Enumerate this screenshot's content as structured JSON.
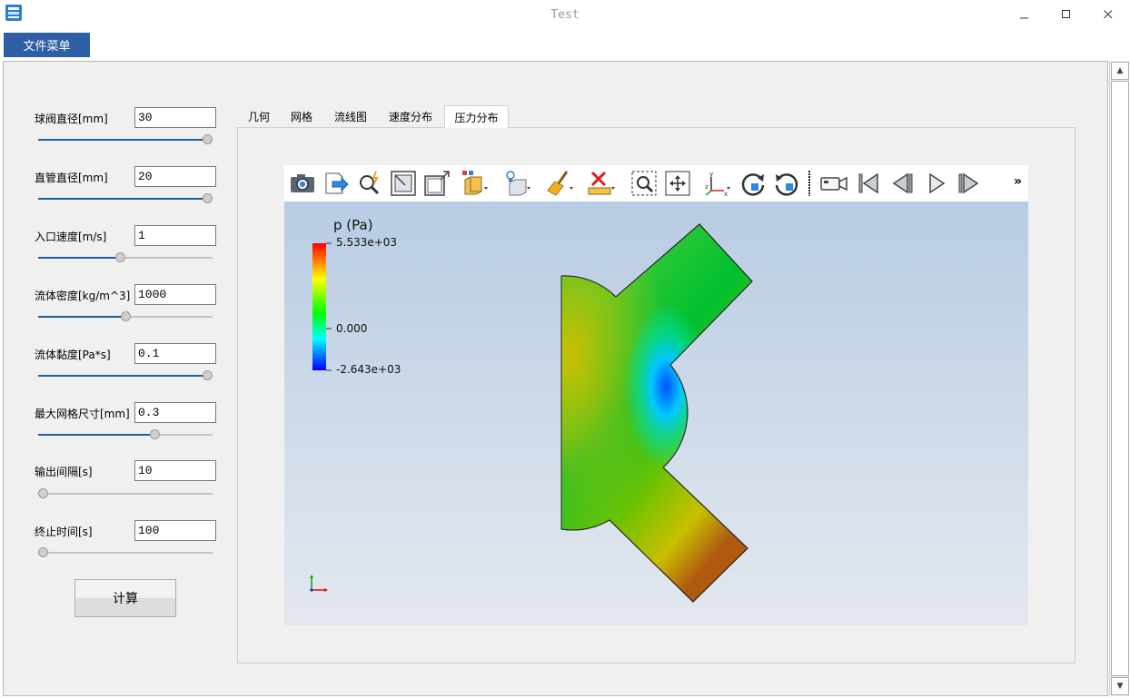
{
  "window": {
    "title": "Test",
    "minimize_icon": "minimize-icon",
    "maximize_icon": "maximize-icon",
    "close_icon": "close-icon",
    "app_icon": "app-icon"
  },
  "menu": {
    "file_menu_label": "文件菜单"
  },
  "parameters": [
    {
      "label": "球阀直径[mm]",
      "value": "30",
      "slider_fraction": 1.0
    },
    {
      "label": "直管直径[mm]",
      "value": "20",
      "slider_fraction": 1.0
    },
    {
      "label": "入口速度[m/s]",
      "value": "1",
      "slider_fraction": 0.47
    },
    {
      "label": "流体密度[kg/m^3]",
      "value": "1000",
      "slider_fraction": 0.505
    },
    {
      "label": "流体黏度[Pa*s]",
      "value": "0.1",
      "slider_fraction": 1.0
    },
    {
      "label": "最大网格尺寸[mm]",
      "value": "0.3",
      "slider_fraction": 0.68
    },
    {
      "label": "输出间隔[s]",
      "value": "10",
      "slider_fraction": 0.0
    },
    {
      "label": "终止时间[s]",
      "value": "100",
      "slider_fraction": 0.0
    }
  ],
  "compute_button_label": "计算",
  "tabs": [
    {
      "label": "几何",
      "active": false
    },
    {
      "label": "网格",
      "active": false
    },
    {
      "label": "流线图",
      "active": false
    },
    {
      "label": "速度分布",
      "active": false
    },
    {
      "label": "压力分布",
      "active": true
    }
  ],
  "toolbar": {
    "icons": [
      "screenshot-camera-icon",
      "export-icon",
      "zoom-magic-icon",
      "fit-view-icon",
      "maximize-view-icon",
      "display-mode-icon",
      "lighting-icon",
      "clear-broom-icon",
      "ruler-measure-icon",
      "zoom-box-icon",
      "pan-icon",
      "axes-icon",
      "rotate-cw-icon",
      "rotate-ccw-icon",
      "video-camera-icon",
      "first-frame-icon",
      "previous-frame-icon",
      "play-icon",
      "next-frame-icon"
    ],
    "overflow_label": "»"
  },
  "legend": {
    "title": "p (Pa)",
    "max_label": "5.533e+03",
    "mid_label": "0.000",
    "min_label": "-2.643e+03",
    "colors": [
      "#ff0000",
      "#ffff00",
      "#00ff00",
      "#00ffff",
      "#0000ff"
    ]
  },
  "field_colors": {
    "inlet": "#b8c900",
    "center": "#00c83c",
    "outlet_top": "#00d25a",
    "outlet_bottom": "#b86a10",
    "low_pressure": "#00a0ff"
  }
}
